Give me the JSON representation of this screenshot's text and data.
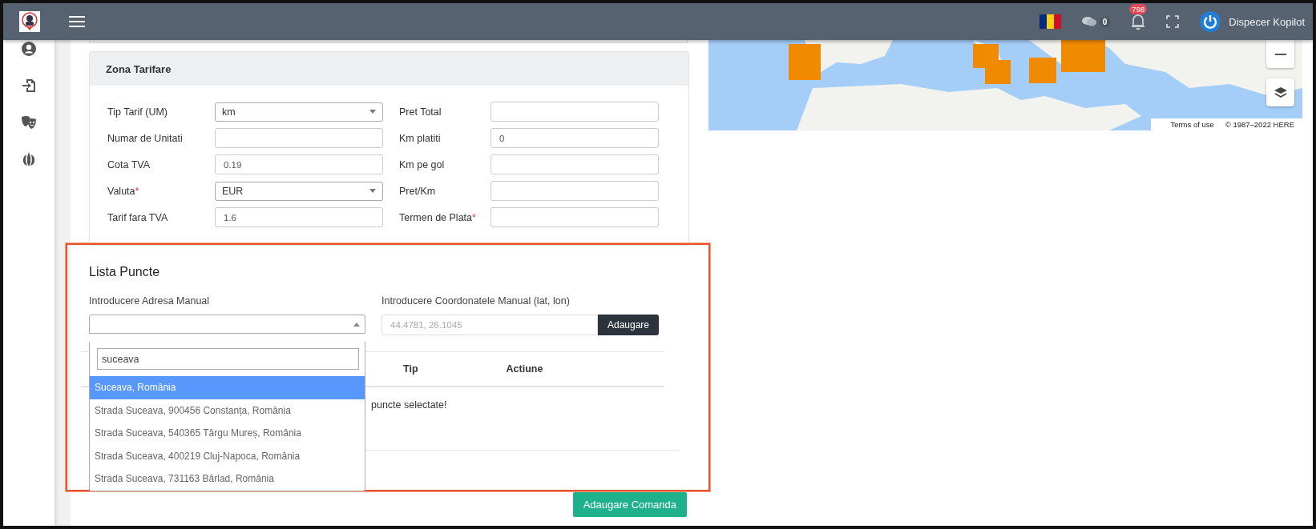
{
  "header": {
    "messages_count": "0",
    "notifications_count": "798",
    "user_name": "Dispecer Kopilot"
  },
  "tariff_zone": {
    "title": "Zona Tarifare",
    "left_fields": [
      {
        "label": "Tip Tarif (UM)",
        "kind": "select",
        "value": "km"
      },
      {
        "label": "Numar de Unitati",
        "kind": "input"
      },
      {
        "label": "Cota TVA",
        "kind": "input",
        "value": "0.19"
      },
      {
        "label": "Valuta",
        "required_mark": "*",
        "kind": "select",
        "value": "EUR"
      },
      {
        "label": "Tarif fara TVA",
        "kind": "input",
        "value": "1.6"
      }
    ],
    "right_fields": [
      {
        "label": "Pret Total",
        "kind": "input"
      },
      {
        "label": "Km platiti",
        "kind": "input",
        "value": "0"
      },
      {
        "label": "Km pe gol",
        "kind": "input"
      },
      {
        "label": "Pret/Km",
        "kind": "input"
      },
      {
        "label": "Termen de Plata",
        "required_mark": "*",
        "kind": "input"
      }
    ]
  },
  "points_list": {
    "title": "Lista Puncte",
    "address_label": "Introducere Adresa Manual",
    "coords_label": "Introducere Coordonatele Manual (lat, lon)",
    "coords_placeholder": "44.4781, 26.1045",
    "add_button": "Adaugare",
    "dropdown": {
      "search_value": "suceava",
      "options": [
        {
          "label": "Suceava, România",
          "selected": true
        },
        {
          "label": "Strada Suceava, 900456 Constanța, România",
          "selected": false
        },
        {
          "label": "Strada Suceava, 540365 Târgu Mureș, România",
          "selected": false
        },
        {
          "label": "Strada Suceava, 400219 Cluj-Napoca, România",
          "selected": false
        },
        {
          "label": "Strada Suceava, 731163 Bârlad, România",
          "selected": false
        }
      ]
    },
    "table": {
      "columns": [
        "Tip",
        "Actiune"
      ],
      "empty_message": "puncte selectate!"
    }
  },
  "map": {
    "terms": "Terms of use",
    "copyright": "© 1987–2022 HERE"
  },
  "submit_button": "Adaugare Comanda"
}
